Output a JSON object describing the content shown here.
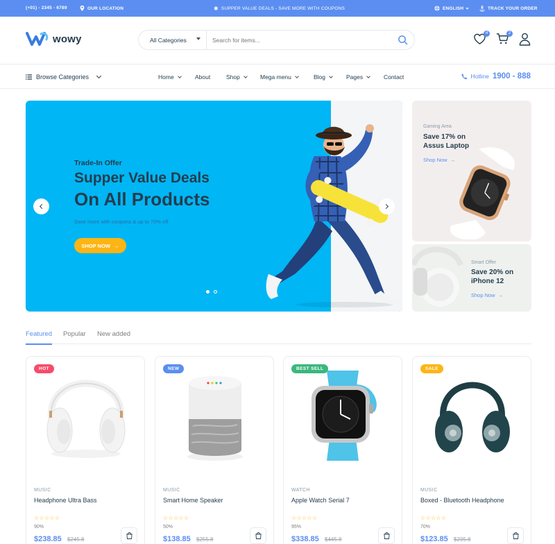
{
  "topbar": {
    "phone": "(+01) - 2345 - 6789",
    "location": "OUR LOCATION",
    "promo": "SUPPER VALUE DEALS - SAVE MORE WITH COUPONS",
    "language": "ENGLISH",
    "track": "TRACK YOUR ORDER"
  },
  "header": {
    "logo_text": "wowy",
    "search": {
      "category": "All Categories",
      "placeholder": "Search for items..."
    },
    "wishlist_count": "4",
    "cart_count": "2"
  },
  "nav": {
    "browse": "Browse Categories",
    "items": [
      {
        "label": "Home",
        "dropdown": true
      },
      {
        "label": "About",
        "dropdown": false
      },
      {
        "label": "Shop",
        "dropdown": true
      },
      {
        "label": "Mega menu",
        "dropdown": true
      },
      {
        "label": "Blog",
        "dropdown": true
      },
      {
        "label": "Pages",
        "dropdown": true
      },
      {
        "label": "Contact",
        "dropdown": false
      }
    ],
    "hotline_label": "Hotline",
    "hotline_number": "1900 - 888"
  },
  "hero": {
    "subtitle": "Trade-In Offer",
    "title1": "Supper Value Deals",
    "title2": "On All Products",
    "desc": "Save more with coupons & up to 70% off",
    "button": "SHOP NOW",
    "active_slide": 1,
    "slides": 2
  },
  "side_banners": [
    {
      "label": "Gaming Area",
      "title1": "Save 17% on",
      "title2": "Assus Laptop",
      "link": "Shop Now"
    },
    {
      "label": "Smart Offer",
      "title1": "Save 20% on",
      "title2": "iPhone 12",
      "link": "Shop Now"
    }
  ],
  "tabs": [
    "Featured",
    "Popular",
    "New added"
  ],
  "active_tab": 0,
  "products": [
    {
      "badge": "HOT",
      "badge_color": "#f74b6a",
      "category": "MUSIC",
      "name": "Headphone Ultra Bass",
      "rating": "90%",
      "price": "$238.85",
      "old_price": "$245.8",
      "stars": "☆☆☆☆☆"
    },
    {
      "badge": "NEW",
      "badge_color": "#5b8ef0",
      "category": "MUSIC",
      "name": "Smart Home Speaker",
      "rating": "50%",
      "price": "$138.85",
      "old_price": "$255.8",
      "stars": "☆☆☆☆☆"
    },
    {
      "badge": "BEST SELL",
      "badge_color": "#3bb77e",
      "category": "WATCH",
      "name": "Apple Watch Serial 7",
      "rating": "95%",
      "price": "$338.85",
      "old_price": "$445.8",
      "stars": "☆☆☆☆☆"
    },
    {
      "badge": "SALE",
      "badge_color": "#fdb515",
      "category": "MUSIC",
      "name": "Boxed - Bluetooth Headphone",
      "rating": "70%",
      "price": "$123.85",
      "old_price": "$235.8",
      "stars": "☆☆☆☆☆"
    }
  ],
  "colors": {
    "primary": "#5b8ef0",
    "hero_bg": "#00b6f5",
    "accent": "#fdb515",
    "text": "#253d4e"
  }
}
